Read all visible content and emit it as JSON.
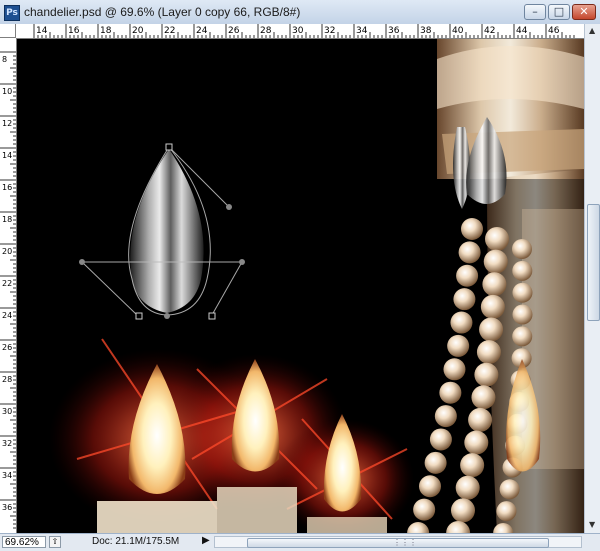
{
  "window": {
    "title": "chandelier.psd @ 69.6% (Layer 0 copy 66, RGB/8#)",
    "app_icon_label": "Ps",
    "app_icon": "photoshop-icon",
    "controls": [
      {
        "name": "minimize-button",
        "glyph": "–"
      },
      {
        "name": "maximize-button",
        "glyph": "□"
      },
      {
        "name": "close-button",
        "glyph": "✕"
      }
    ]
  },
  "ruler": {
    "horizontal_labels": [
      "14",
      "16",
      "18",
      "20",
      "22",
      "24",
      "26",
      "28",
      "30",
      "32",
      "34",
      "36",
      "38",
      "40",
      "42",
      "44",
      "46"
    ],
    "vertical_labels": [
      "8",
      "10",
      "12",
      "14",
      "16",
      "18",
      "20",
      "22",
      "24",
      "26",
      "28",
      "30",
      "32",
      "34",
      "36"
    ]
  },
  "status": {
    "zoom": "69.62%",
    "doc_info": "Doc: 21.1M/175.5M",
    "menu_arrow": "▶"
  },
  "canvas": {
    "background": "#000000",
    "glow_color": "#ff3b1f",
    "flame_color": "#fff3c4",
    "crystal_color": "#e8d3b8"
  }
}
